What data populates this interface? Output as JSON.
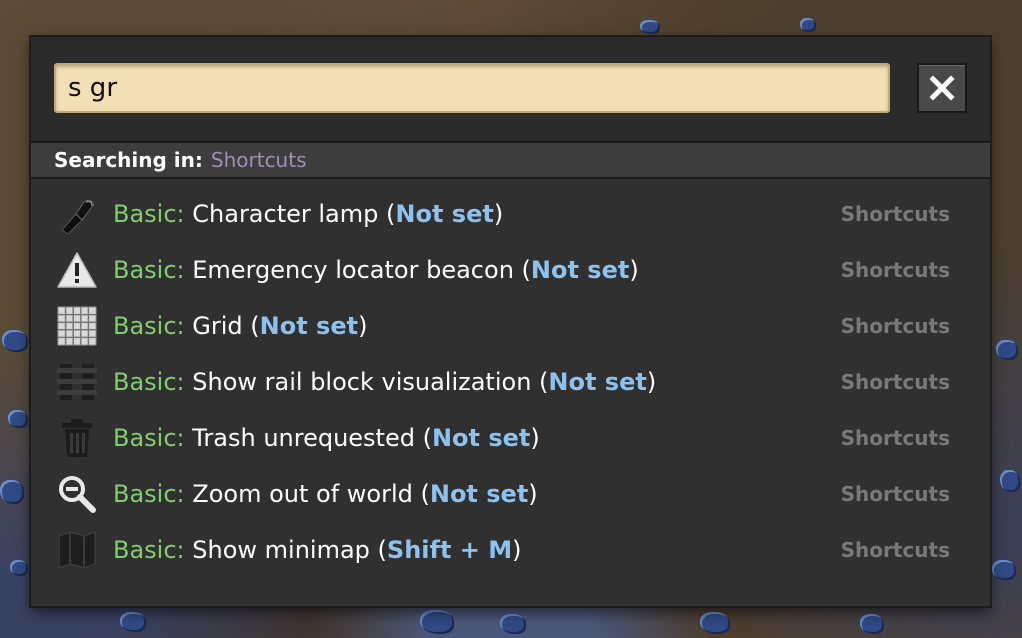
{
  "search": {
    "value": "s gr",
    "close_label": "✕"
  },
  "scope": {
    "label": "Searching in:",
    "value": "Shortcuts"
  },
  "results": [
    {
      "category": "Basic:",
      "name": "Character lamp",
      "open": " (",
      "key": "Not set",
      "close": ")",
      "source": "Shortcuts",
      "icon": "flashlight-icon"
    },
    {
      "category": "Basic:",
      "name": "Emergency locator beacon",
      "open": " (",
      "key": "Not set",
      "close": ")",
      "source": "Shortcuts",
      "icon": "warning-icon"
    },
    {
      "category": "Basic:",
      "name": "Grid",
      "open": " (",
      "key": "Not set",
      "close": ")",
      "source": "Shortcuts",
      "icon": "grid-icon"
    },
    {
      "category": "Basic:",
      "name": "Show rail block visualization",
      "open": " (",
      "key": "Not set",
      "close": ")",
      "source": "Shortcuts",
      "icon": "rail-block-icon"
    },
    {
      "category": "Basic:",
      "name": "Trash unrequested",
      "open": " (",
      "key": "Not set",
      "close": ")",
      "source": "Shortcuts",
      "icon": "trash-icon"
    },
    {
      "category": "Basic:",
      "name": "Zoom out of world",
      "open": " (",
      "key": "Not set",
      "close": ")",
      "source": "Shortcuts",
      "icon": "zoom-out-icon"
    },
    {
      "category": "Basic:",
      "name": "Show minimap",
      "open": " (",
      "key": "Shift + M",
      "close": ")",
      "source": "Shortcuts",
      "icon": "map-icon"
    }
  ],
  "colors": {
    "panel": "#313031",
    "input_bg": "#f2dfb5",
    "category": "#7fce6a",
    "keybind": "#8ec2ee",
    "scope_value": "#9c90b3",
    "source": "#7a797a"
  }
}
